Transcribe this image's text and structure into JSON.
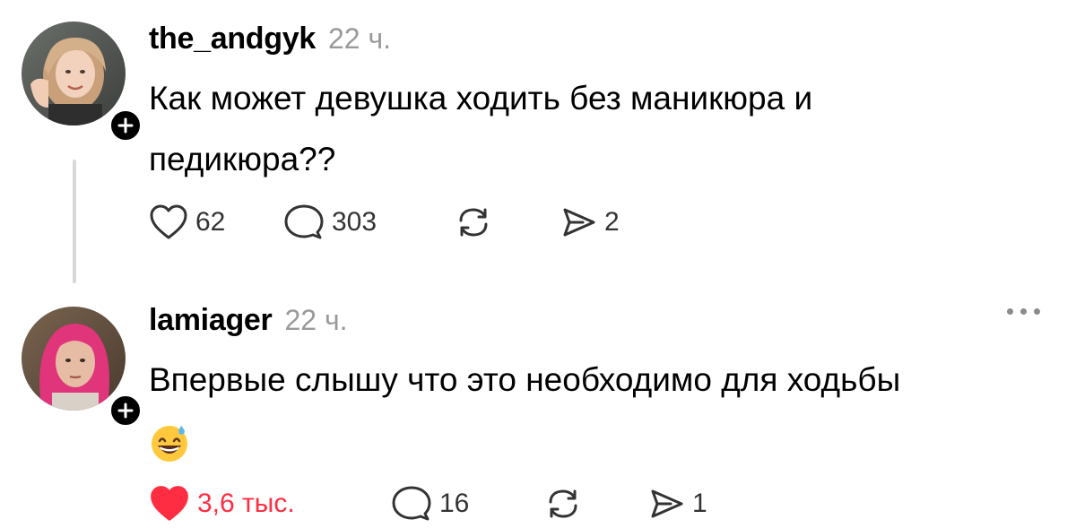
{
  "posts": [
    {
      "username": "the_andgyk",
      "time": "22 ч.",
      "text_line1": "Как может девушка ходить без маникюра и",
      "text_line2": "педикюра??",
      "likes": "62",
      "comments": "303",
      "shares": "2",
      "liked": false,
      "avatar_icon": "user-avatar",
      "follow_icon": "plus-icon"
    },
    {
      "username": "lamiager",
      "time": "22 ч.",
      "text_line1": "Впервые слышу что это необходимо для ходьбы",
      "text_emoji": "grinning-face-with-sweat-emoji",
      "likes": "3,6 тыс.",
      "comments": "16",
      "shares": "1",
      "liked": true,
      "avatar_icon": "user-avatar",
      "follow_icon": "plus-icon",
      "menu_icon": "more-icon"
    }
  ],
  "colors": {
    "liked_red": "#ff2d41",
    "muted_gray": "#9a9a9a",
    "thread_line": "#d8d8d8"
  }
}
